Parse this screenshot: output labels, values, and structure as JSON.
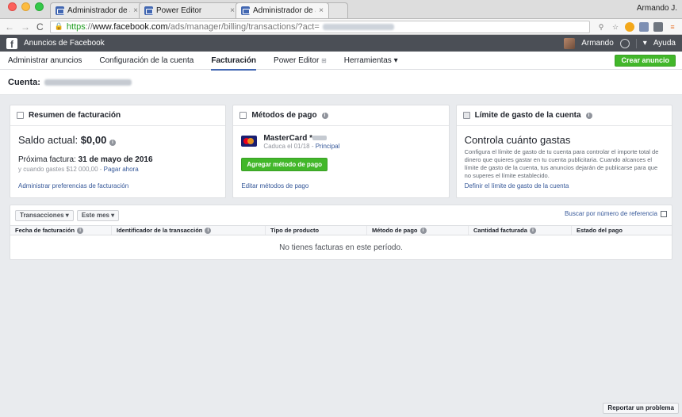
{
  "browser": {
    "tabs": [
      {
        "title": "Administrador de anuncios",
        "close": "×"
      },
      {
        "title": "Power Editor",
        "close": "×"
      },
      {
        "title": "Administrador de anuncios",
        "close": "×"
      }
    ],
    "profile": "Armando J.",
    "url_https": "https",
    "url_sep": "://",
    "url_host": "www.facebook.com",
    "url_path": "/ads/manager/billing/transactions/?act="
  },
  "fb": {
    "app_name": "Anuncios de Facebook",
    "user_name": "Armando",
    "help": "Ayuda",
    "dropdown_arrow": "▾"
  },
  "subnav": {
    "items": [
      "Administrar anuncios",
      "Configuración de la cuenta",
      "Facturación",
      "Power Editor",
      "Herramientas ▾"
    ],
    "create_button": "Crear anuncio"
  },
  "account": {
    "label": "Cuenta:"
  },
  "billing_summary": {
    "title": "Resumen de facturación",
    "balance_label": "Saldo actual:",
    "balance_value": "$0,00",
    "next_bill_label": "Próxima factura:",
    "next_bill_date": "31 de mayo de 2016",
    "threshold_text": "y cuando gastes $12 000,00 - ",
    "pay_now": "Pagar ahora",
    "footer_link": "Administrar preferencias de facturación"
  },
  "payment_methods": {
    "title": "Métodos de pago",
    "card_name": "MasterCard *",
    "expires": "Caduca el 01/18 - ",
    "principal": "Principal",
    "add_button": "Agregar método de pago",
    "footer_link": "Editar métodos de pago"
  },
  "spend_limit": {
    "title": "Límite de gasto de la cuenta",
    "heading": "Controla cuánto gastas",
    "description": "Configura el límite de gasto de tu cuenta para controlar el importe total de dinero que quieres gastar en tu cuenta publicitaria. Cuando alcances el límite de gasto de la cuenta, tus anuncios dejarán de publicarse para que no superes el límite establecido.",
    "footer_link": "Definir el límite de gasto de la cuenta"
  },
  "transactions": {
    "filter_type": "Transacciones ▾",
    "filter_period": "Este mes ▾",
    "search_ref": "Buscar por número de referencia",
    "columns": [
      "Fecha de facturación",
      "Identificador de la transacción",
      "Tipo de producto",
      "Método de pago",
      "Cantidad facturada",
      "Estado del pago"
    ],
    "empty_message": "No tienes facturas en este período."
  },
  "report_button": "Reportar un problema"
}
